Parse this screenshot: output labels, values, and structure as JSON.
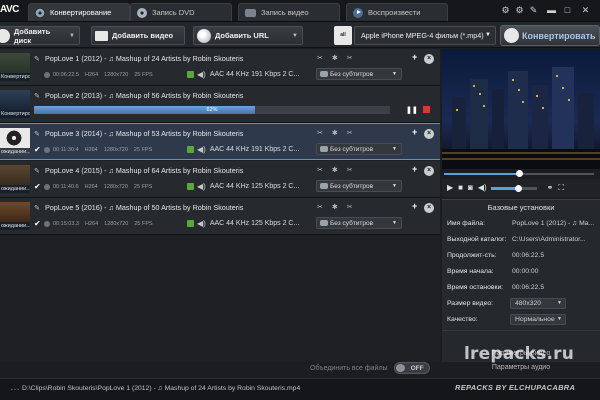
{
  "app": {
    "logo": "AVC"
  },
  "tabs": [
    {
      "label": "Конвертирование",
      "icon": "film-reel-icon",
      "active": true
    },
    {
      "label": "Запись DVD",
      "icon": "disc-icon",
      "active": false
    },
    {
      "label": "Запись видео",
      "icon": "camera-icon",
      "active": false
    },
    {
      "label": "Воспроизвести",
      "icon": "play-icon",
      "active": false
    }
  ],
  "window_controls": {
    "settings": "⚙",
    "tools": "⚙",
    "key": "✎",
    "minimize": "▬",
    "maximize": "□",
    "close": "✕"
  },
  "toolbar": {
    "add_disc": "Добавить диск",
    "add_video": "Добавить видео",
    "add_url": "Добавить URL",
    "format_icon_text": "all",
    "format_selected": "Apple iPhone MPEG-4 фильм (*.mp4)",
    "convert": "Конвертировать"
  },
  "files": [
    {
      "title": "PopLove 1 (2012) - ♫ Mashup of 24 Artists by Robin Skouteris",
      "duration": "00:06:22.5",
      "codec": "H264",
      "resolution": "1280x720",
      "fps": "25 FPS",
      "audio": "AAC 44 KHz 191 Kbps 2 C...",
      "subtitles": "Без субтитров",
      "thumb_label": "Конвертиров...",
      "checked": true,
      "state": "normal"
    },
    {
      "title": "PopLove 2 (2013) - ♫ Mashup of 56 Artists by Robin Skouteris",
      "progress_text": "62%",
      "progress": 0.62,
      "thumb_label": "Конвертирова",
      "state": "converting"
    },
    {
      "title": "PopLove 3 (2014) - ♫ Mashup of 53 Artists by Robin Skouteris",
      "duration": "00:11:30.4",
      "codec": "H264",
      "resolution": "1280x720",
      "fps": "25 FPS",
      "audio": "AAC 44 KHz 191 Kbps 2 C...",
      "subtitles": "Без субтитров",
      "thumb_label": "ожидании...",
      "checked": true,
      "state": "selected"
    },
    {
      "title": "PopLove 4 (2015) - ♫ Mashup of 64 Artists by Robin Skouteris",
      "duration": "00:11:40.6",
      "codec": "H264",
      "resolution": "1280x720",
      "fps": "25 FPS",
      "audio": "AAC 44 KHz 125 Kbps 2 C...",
      "subtitles": "Без субтитров",
      "thumb_label": "ожидании...",
      "checked": true,
      "state": "normal"
    },
    {
      "title": "PopLove 5 (2016) - ♫ Mashup of 50 Artists by Robin Skouteris",
      "duration": "00:15:03.3",
      "codec": "H264",
      "resolution": "1280x720",
      "fps": "25 FPS",
      "audio": "AAC 44 KHz 125 Kbps 2 C...",
      "subtitles": "Без субтитров",
      "thumb_label": "ожидании...",
      "checked": true,
      "state": "normal"
    }
  ],
  "merge": {
    "label": "Объединить все файлы",
    "toggle": "OFF"
  },
  "player": {
    "seek_position": 0.5,
    "volume": 0.6
  },
  "settings": {
    "title": "Базовые установки",
    "rows": [
      {
        "key": "Имя файла:",
        "value": "PopLove 1 (2012) - ♫ Ma..."
      },
      {
        "key": "Выходной каталог:",
        "value": "C:\\Users\\Administrator..."
      },
      {
        "key": "Продолжит-сть:",
        "value": "00:06:22.5"
      },
      {
        "key": "Время начала:",
        "value": "00:00:00"
      },
      {
        "key": "Время остановки:",
        "value": "00:06:22.5"
      },
      {
        "key": "Размер видео:",
        "value": "480x320"
      },
      {
        "key": "Качество:",
        "value": "Нормальное"
      }
    ],
    "video_params": "Параметры видео",
    "audio_params": "Параметры аудио"
  },
  "statusbar": {
    "path": "D:\\Clips\\Robin Skouteris\\PopLove 1 (2012) - ♫ Mashup of 24 Artists by Robin Skouteris.mp4"
  },
  "watermark": {
    "site": "lrepacks.ru",
    "author": "REPACKS BY ELCHUPACABRA"
  }
}
